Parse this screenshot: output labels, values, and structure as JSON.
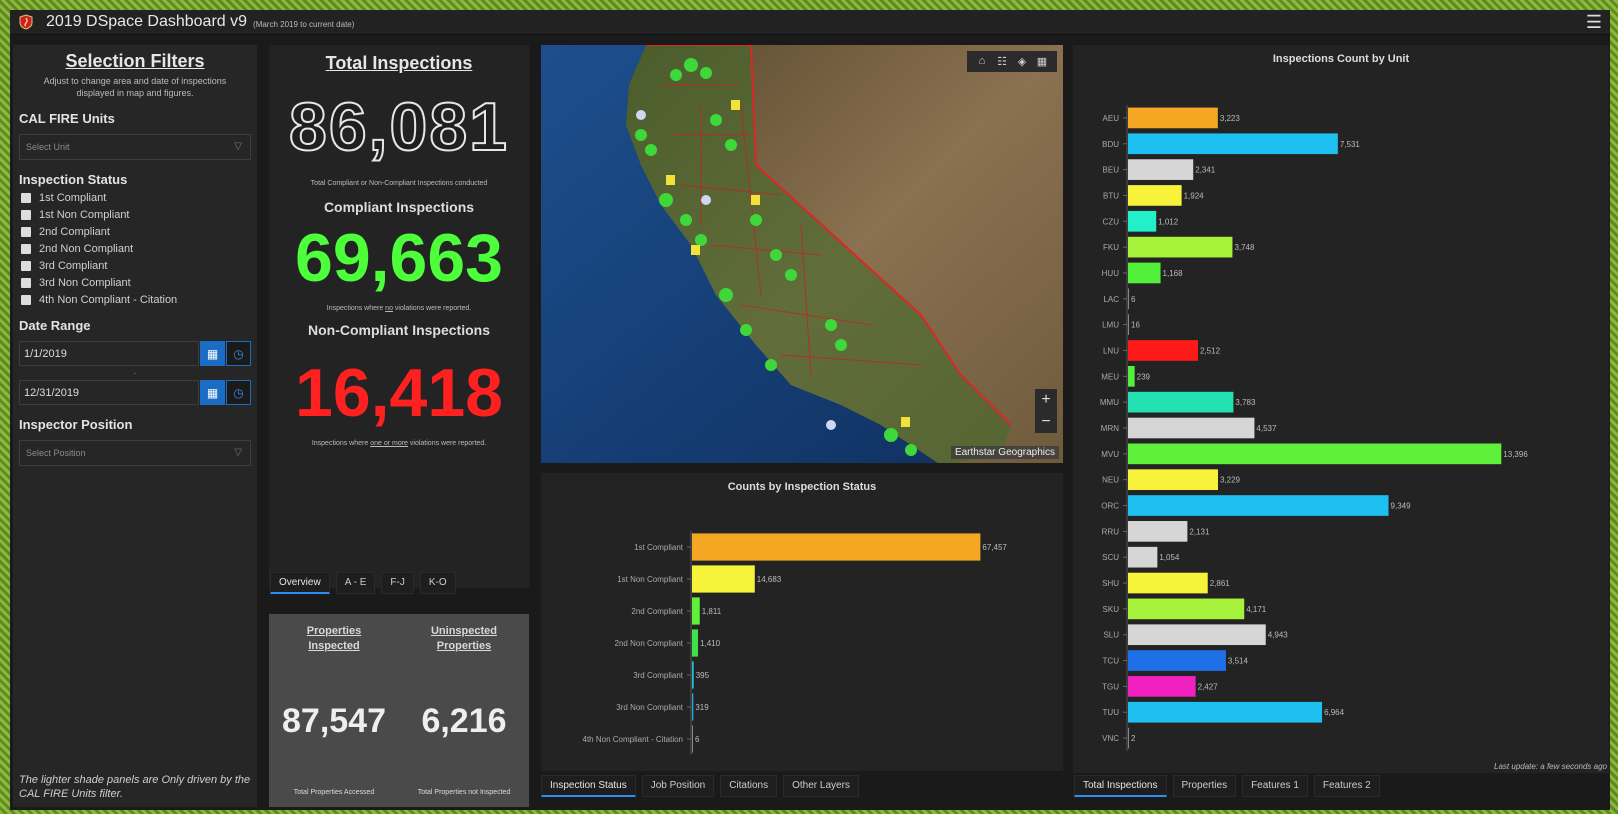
{
  "header": {
    "title": "2019 DSpace Dashboard v9",
    "subtitle": "(March 2019 to current date)"
  },
  "filters": {
    "title": "Selection Filters",
    "hint": "Adjust to change area and date of inspections displayed in map and figures.",
    "units_label": "CAL FIRE Units",
    "units_placeholder": "Select Unit",
    "status_label": "Inspection Status",
    "status_options": [
      "1st Compliant",
      "1st Non Compliant",
      "2nd Compliant",
      "2nd Non Compliant",
      "3rd Compliant",
      "3rd Non Compliant",
      "4th Non Compliant - Citation"
    ],
    "date_label": "Date Range",
    "date_start": "1/1/2019",
    "date_sep": "-",
    "date_end": "12/31/2019",
    "position_label": "Inspector Position",
    "position_placeholder": "Select Position",
    "note": "The lighter shade panels are Only driven by the CAL FIRE Units filter."
  },
  "totals": {
    "title": "Total Inspections",
    "total": "86,081",
    "total_caption": "Total Compliant or Non-Compliant Inspections conducted",
    "compliant_title": "Compliant Inspections",
    "compliant": "69,663",
    "compliant_caption_pre": "Inspections where ",
    "compliant_caption_em": "no",
    "compliant_caption_post": " violations were reported.",
    "noncompliant_title": "Non-Compliant Inspections",
    "noncompliant": "16,418",
    "noncompliant_caption_pre": "Inspections where ",
    "noncompliant_caption_em": "one or more",
    "noncompliant_caption_post": " violations were reported.",
    "tabs": [
      "Overview",
      "A - E",
      "F-J",
      "K-O"
    ]
  },
  "properties": {
    "inspected_label_1": "Properties",
    "inspected_label_2": "Inspected",
    "uninspected_label_1": "Uninspected",
    "uninspected_label_2": "Properties",
    "inspected": "87,547",
    "uninspected": "6,216",
    "inspected_caption": "Total Properties Accessed",
    "uninspected_caption": "Total Properties not Inspected"
  },
  "map": {
    "attribution": "Earthstar Geographics",
    "tools": [
      "home-icon",
      "legend-icon",
      "layers-icon",
      "basemap-icon"
    ],
    "zoom_in": "+",
    "zoom_out": "−"
  },
  "middle_tabs": [
    "Inspection Status",
    "Job Position",
    "Citations",
    "Other Layers"
  ],
  "right_tabs": [
    "Total Inspections",
    "Properties",
    "Features 1",
    "Features 2"
  ],
  "last_update": "Last update: a few seconds ago",
  "colors": {
    "accent": "#2a8ff0",
    "green": "#4cff3a",
    "red": "#ff2020"
  },
  "chart_data": [
    {
      "type": "bar",
      "orientation": "horizontal",
      "title": "Counts by Inspection Status",
      "categories": [
        "1st Compliant",
        "1st Non Compliant",
        "2nd Compliant",
        "2nd Non Compliant",
        "3rd Compliant",
        "3rd Non Compliant",
        "4th Non Compliant - Citation"
      ],
      "values": [
        67457,
        14683,
        1811,
        1410,
        395,
        319,
        6
      ],
      "labels": [
        "67,457",
        "14,683",
        "1,811",
        "1,410",
        "395",
        "319",
        "6"
      ],
      "colors": [
        "#f5a623",
        "#f7f23a",
        "#5ef03a",
        "#3fe04a",
        "#22c2e0",
        "#1fa7e6",
        "#888888"
      ],
      "xticks": [
        "0",
        "20,000",
        "40,000",
        "60,000",
        "80,000"
      ],
      "xlim": [
        0,
        80000
      ],
      "grid": false
    },
    {
      "type": "bar",
      "orientation": "horizontal",
      "title": "Inspections Count by Unit",
      "categories": [
        "AEU",
        "BDU",
        "BEU",
        "BTU",
        "CZU",
        "FKU",
        "HUU",
        "LAC",
        "LMU",
        "LNU",
        "MEU",
        "MMU",
        "MRN",
        "MVU",
        "NEU",
        "ORC",
        "RRU",
        "SCU",
        "SHU",
        "SKU",
        "SLU",
        "TCU",
        "TGU",
        "TUU",
        "VNC"
      ],
      "values": [
        3223,
        7531,
        2341,
        1924,
        1012,
        3748,
        1168,
        6,
        16,
        2512,
        239,
        3783,
        4537,
        13396,
        3229,
        9349,
        2131,
        1054,
        2861,
        4171,
        4943,
        3514,
        2427,
        6964,
        2
      ],
      "labels": [
        "3,223",
        "7,531",
        "2,341",
        "1,924",
        "1,012",
        "3,748",
        "1,168",
        "6",
        "16",
        "2,512",
        "239",
        "3,783",
        "4,537",
        "13,396",
        "3,229",
        "9,349",
        "2,131",
        "1,054",
        "2,861",
        "4,171",
        "4,943",
        "3,514",
        "2,427",
        "6,964",
        "2"
      ],
      "colors": [
        "#f5a623",
        "#1ec0f2",
        "#d6d6d6",
        "#f7f23a",
        "#22f0c8",
        "#a6f23a",
        "#52f03a",
        "#888888",
        "#888888",
        "#ff1a1a",
        "#52f03a",
        "#22e0b0",
        "#d6d6d6",
        "#5ef03a",
        "#f7f23a",
        "#1ec0f2",
        "#d6d6d6",
        "#d6d6d6",
        "#f7f23a",
        "#a6f23a",
        "#d6d6d6",
        "#1f6fe8",
        "#f021c0",
        "#1ec0f2",
        "#888888"
      ],
      "xticks": [
        "0",
        "5,000",
        "10,000",
        "15,000"
      ],
      "xlim": [
        0,
        15000
      ],
      "grid": false
    }
  ]
}
